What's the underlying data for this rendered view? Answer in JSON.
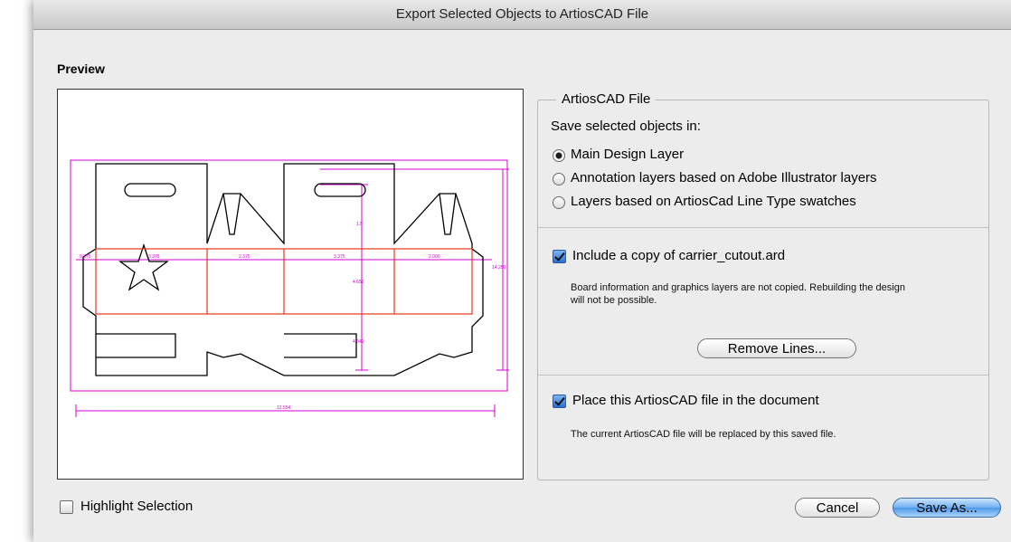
{
  "window": {
    "title": "Export Selected Objects to ArtiosCAD File"
  },
  "preview": {
    "label": "Preview",
    "dims": {
      "glue_flap": "0.375",
      "panel_a": "3.375",
      "panel_b": "2.375",
      "panel_c": "3.375",
      "panel_d": "2.000",
      "height_main": "4.652",
      "height_top": "1.5",
      "height_bottom": "4.049",
      "overall_height": "14.250",
      "overall_width": "12.554"
    },
    "colors": {
      "cut": "#000000",
      "crease": "#e8361e",
      "dimension": "#d400d4"
    }
  },
  "group": {
    "legend": "ArtiosCAD File",
    "save_in_label": "Save selected objects in:",
    "options": [
      {
        "label": "Main Design Layer",
        "selected": true
      },
      {
        "label": "Annotation layers based on Adobe Illustrator layers",
        "selected": false
      },
      {
        "label": "Layers based on ArtiosCad Line Type swatches",
        "selected": false
      }
    ],
    "include_copy": {
      "label": "Include a copy of carrier_cutout.ard",
      "checked": true
    },
    "include_note_1": "Board information and graphics layers are not copied.  Rebuilding the design",
    "include_note_2": "will not be possible.",
    "remove_lines_label": "Remove Lines...",
    "place_file": {
      "label": "Place this ArtiosCAD file in the document",
      "checked": true
    },
    "place_note": "The current ArtiosCAD file will be replaced by this saved file."
  },
  "footer": {
    "highlight": {
      "label": "Highlight Selection",
      "checked": false
    },
    "cancel_label": "Cancel",
    "save_label": "Save As..."
  }
}
